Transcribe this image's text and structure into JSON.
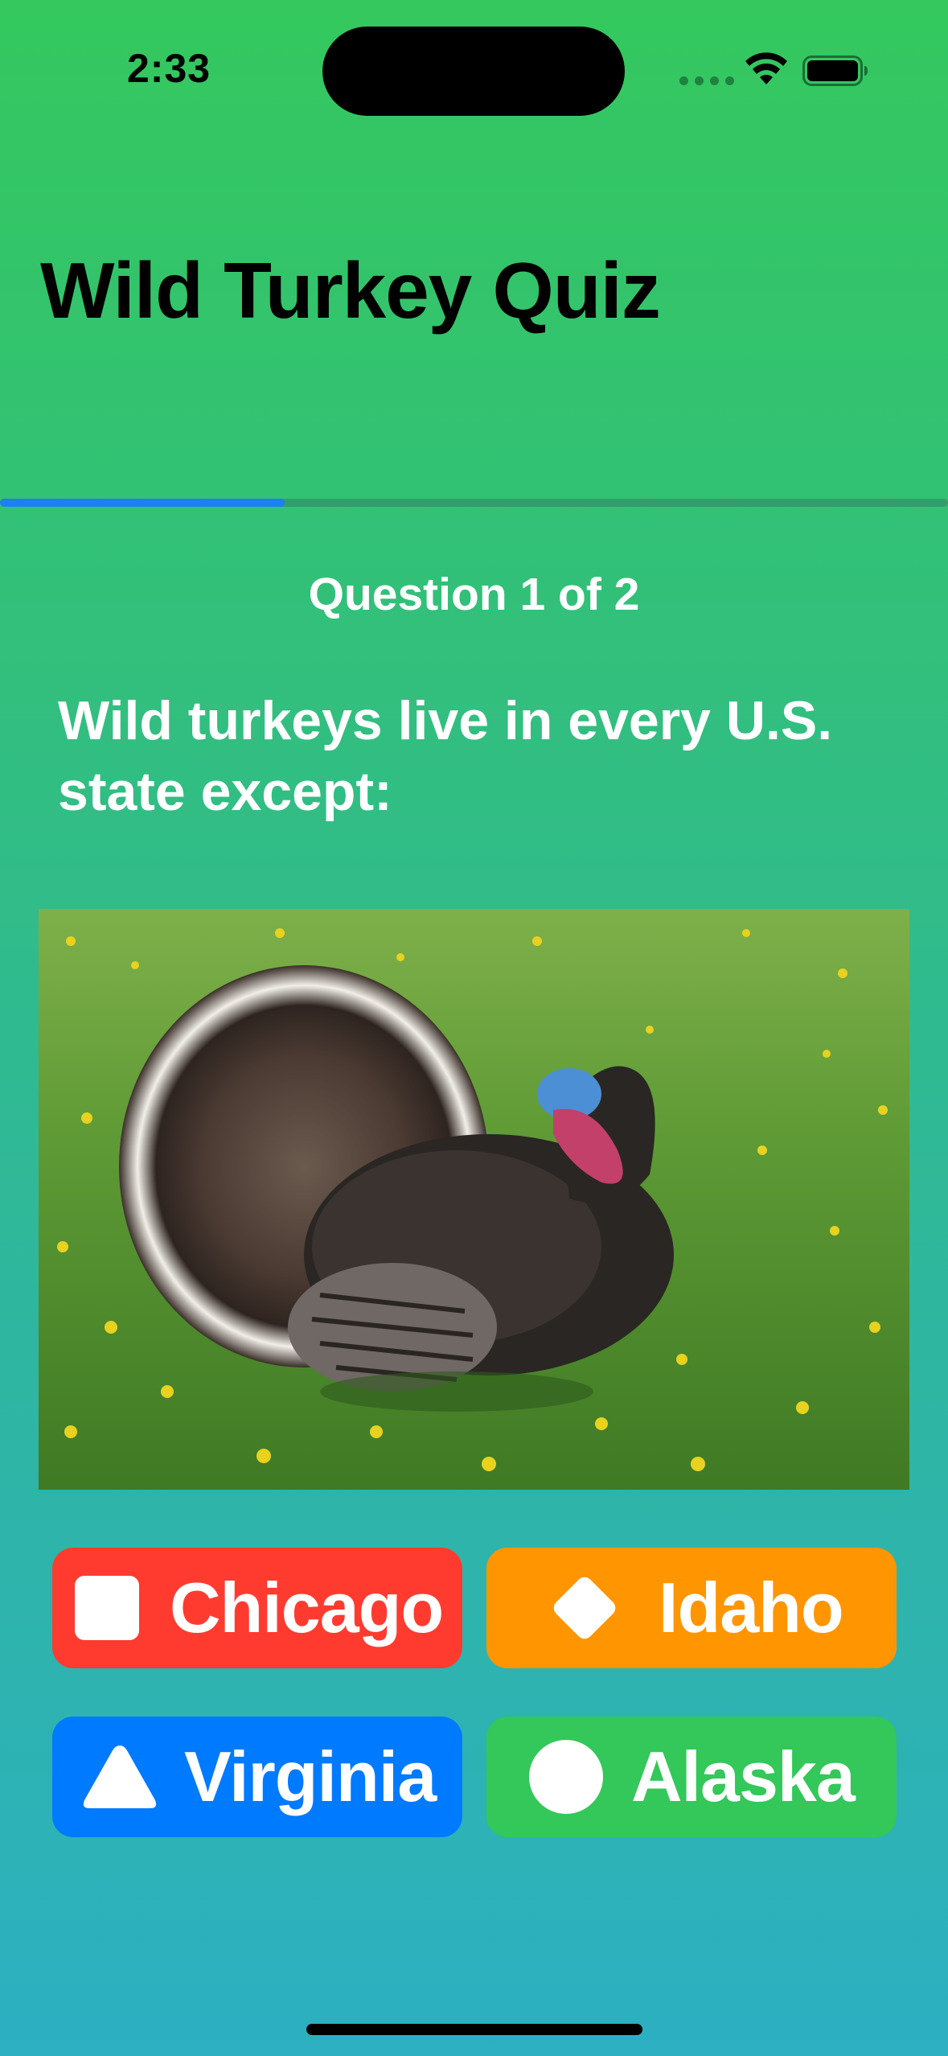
{
  "status_bar": {
    "time": "2:33",
    "icons": [
      "signal-dots-icon",
      "wifi-icon",
      "battery-icon"
    ]
  },
  "title": "Wild Turkey Quiz",
  "progress": {
    "fraction": 0.3
  },
  "question": {
    "counter": "Question 1 of 2",
    "text": "Wild turkeys live in every U.S. state except:",
    "image_subject": "wild turkey displaying tail fan in grassy field"
  },
  "answers": [
    {
      "label": "Chicago",
      "shape": "square-icon",
      "color": "#ff3b30"
    },
    {
      "label": "Idaho",
      "shape": "diamond-icon",
      "color": "#ff9500"
    },
    {
      "label": "Virginia",
      "shape": "triangle-icon",
      "color": "#007aff"
    },
    {
      "label": "Alaska",
      "shape": "circle-icon",
      "color": "#34c759"
    }
  ],
  "colors": {
    "background_top": "#34c85e",
    "background_bottom": "#2cb0c2",
    "progress_fill": "#1c7ff2"
  }
}
